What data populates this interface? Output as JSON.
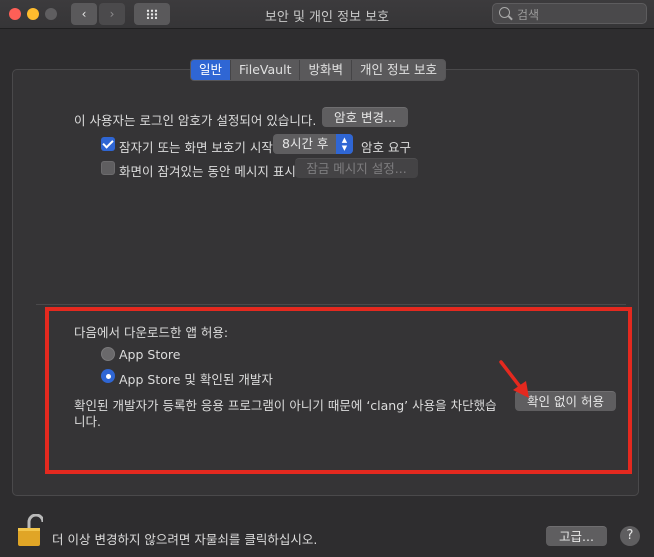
{
  "window": {
    "title": "보안 및 개인 정보 보호",
    "back_icon": "‹",
    "forward_icon": "›",
    "search_placeholder": "검색"
  },
  "tabs": [
    {
      "label": "일반",
      "active": true
    },
    {
      "label": "FileVault",
      "active": false
    },
    {
      "label": "방화벽",
      "active": false
    },
    {
      "label": "개인 정보 보호",
      "active": false
    }
  ],
  "general": {
    "login_password_text": "이 사용자는 로그인 암호가 설정되어 있습니다.",
    "change_password_button": "암호 변경...",
    "require_password_label": "잠자기 또는 화면 보호기 시작",
    "require_password_checked": true,
    "require_password_delay": "8시간 후",
    "require_password_suffix": "암호 요구",
    "lock_message_label": "화면이 잠겨있는 동안 메시지 표시",
    "lock_message_checked": false,
    "lock_message_button": "잠금 메시지 설정..."
  },
  "downloads": {
    "heading": "다음에서 다운로드한 앱 허용:",
    "options": [
      {
        "label": "App Store",
        "selected": false
      },
      {
        "label": "App Store 및 확인된 개발자",
        "selected": true
      }
    ],
    "blocked_message_line1": "확인된 개발자가 등록한 응용 프로그램이 아니기 때문에 ‘clang’ 사용을 차단했습",
    "blocked_message_line2": "니다.",
    "allow_anyway_button": "확인 없이 허용"
  },
  "footer": {
    "lock_text": "더 이상 변경하지 않으려면 자물쇠를 클릭하십시오.",
    "advanced_button": "고급...",
    "help_label": "?"
  },
  "colors": {
    "accent": "#2f66d4",
    "highlight_box": "#e4291f"
  }
}
